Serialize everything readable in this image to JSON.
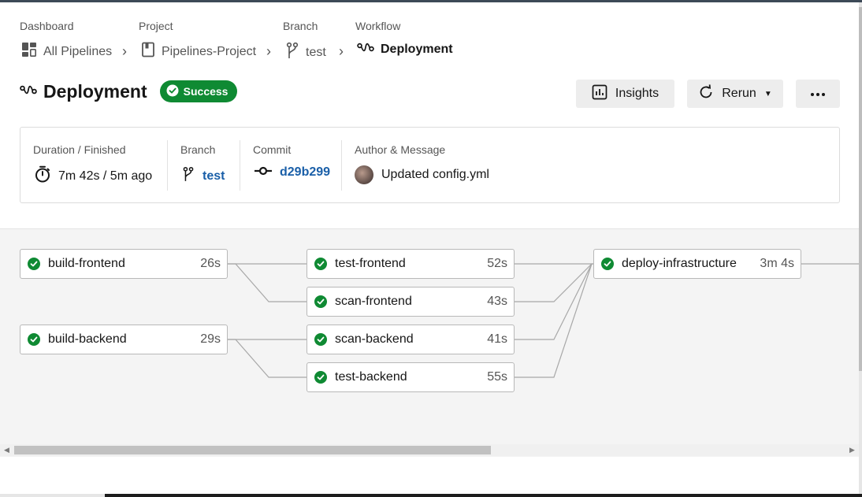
{
  "breadcrumb": {
    "labels": [
      "Dashboard",
      "Project",
      "Branch",
      "Workflow"
    ],
    "items": [
      {
        "text": "All Pipelines",
        "icon": "dashboard-icon"
      },
      {
        "text": "Pipelines-Project",
        "icon": "project-icon"
      },
      {
        "text": "test",
        "icon": "branch-icon"
      },
      {
        "text": "Deployment",
        "icon": "workflow-icon"
      }
    ]
  },
  "header": {
    "title": "Deployment",
    "status": "Success",
    "insights_label": "Insights",
    "rerun_label": "Rerun"
  },
  "info": {
    "duration_label": "Duration / Finished",
    "duration_value": "7m 42s / 5m ago",
    "branch_label": "Branch",
    "branch_value": "test",
    "commit_label": "Commit",
    "commit_value": "d29b299",
    "author_label": "Author & Message",
    "author_message": "Updated config.yml"
  },
  "jobs": [
    {
      "name": "build-frontend",
      "duration": "26s"
    },
    {
      "name": "build-backend",
      "duration": "29s"
    },
    {
      "name": "test-frontend",
      "duration": "52s"
    },
    {
      "name": "scan-frontend",
      "duration": "43s"
    },
    {
      "name": "scan-backend",
      "duration": "41s"
    },
    {
      "name": "test-backend",
      "duration": "55s"
    },
    {
      "name": "deploy-infrastructure",
      "duration": "3m 4s"
    }
  ],
  "colors": {
    "success": "#0f8a33",
    "link": "#1a5fa8",
    "graph_background": "#f4f4f4"
  }
}
